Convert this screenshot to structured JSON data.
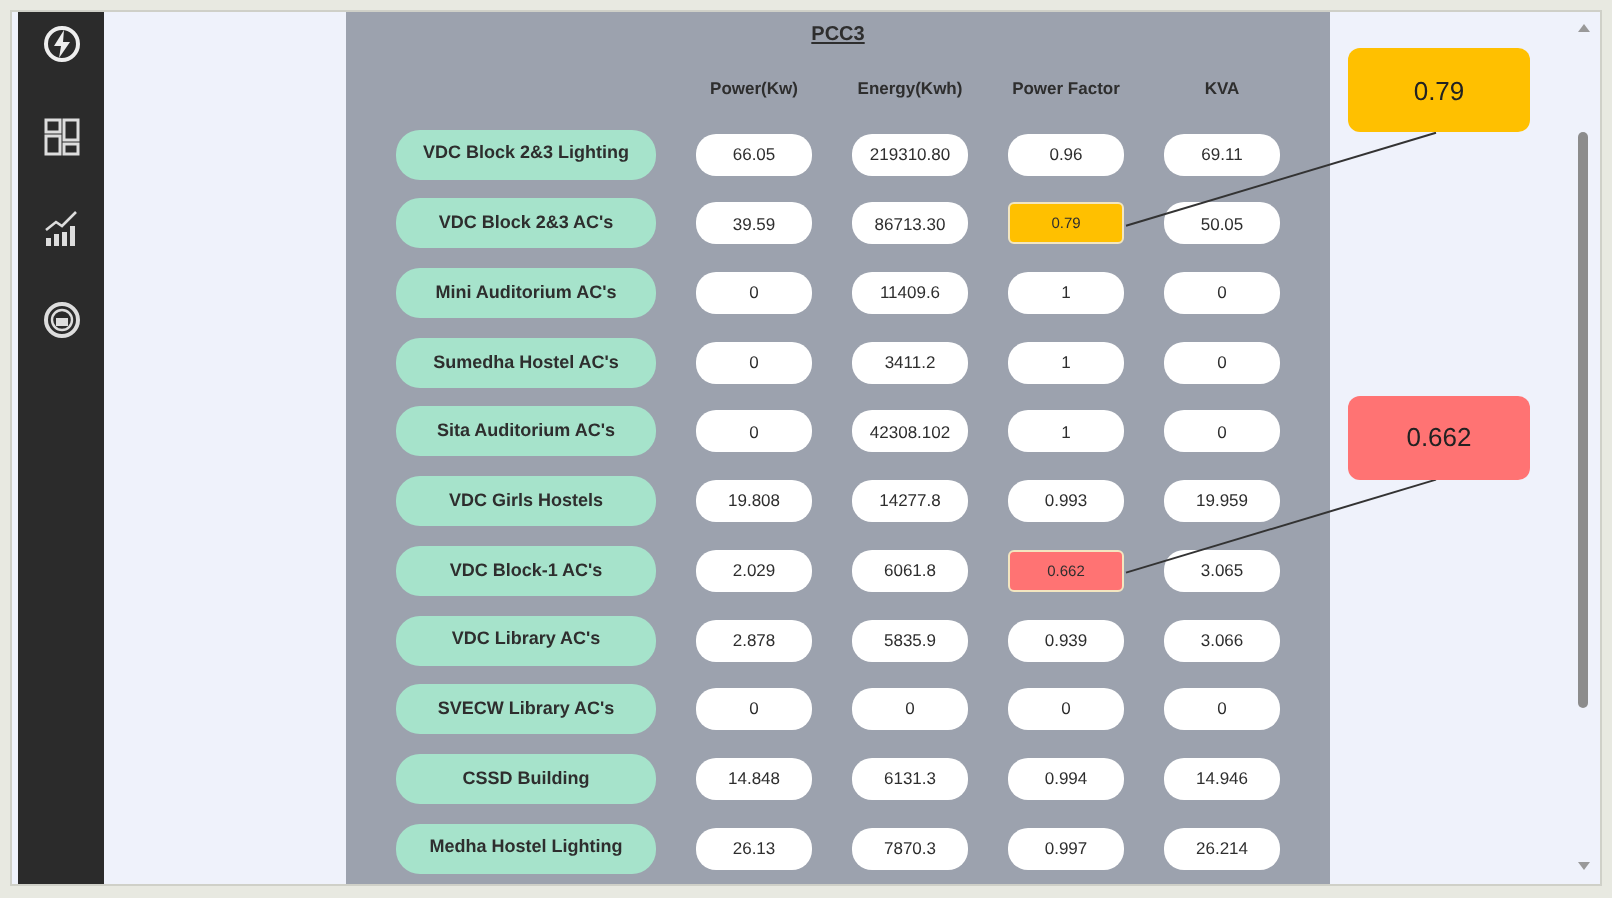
{
  "panel": {
    "title": "PCC3",
    "columns": [
      "Power(Kw)",
      "Energy(Kwh)",
      "Power Factor",
      "KVA"
    ],
    "rows": [
      {
        "name": "VDC Block 2&3 Lighting",
        "values": [
          "66.05",
          "219310.80",
          "0.96",
          "69.11"
        ]
      },
      {
        "name": "VDC Block 2&3 AC's",
        "values": [
          "39.59",
          "86713.30",
          {
            "text": "0.79",
            "color": "#ffc000",
            "callout": "0.79"
          },
          "50.05"
        ]
      },
      {
        "name": "Mini Auditorium AC's",
        "values": [
          "0",
          "11409.6",
          "1",
          "0"
        ]
      },
      {
        "name": "Sumedha Hostel AC's",
        "values": [
          "0",
          "3411.2",
          "1",
          "0"
        ]
      },
      {
        "name": "Sita Auditorium AC's",
        "values": [
          "0",
          "42308.102",
          "1",
          "0"
        ]
      },
      {
        "name": "VDC Girls Hostels",
        "values": [
          "19.808",
          "14277.8",
          "0.993",
          "19.959"
        ]
      },
      {
        "name": "VDC Block-1 AC's",
        "values": [
          "2.029",
          "6061.8",
          {
            "text": "0.662",
            "color": "#ff7373",
            "callout": "0.662"
          },
          "3.065"
        ]
      },
      {
        "name": "VDC Library AC's",
        "values": [
          "2.878",
          "5835.9",
          "0.939",
          "3.066"
        ]
      },
      {
        "name": "SVECW Library AC's",
        "values": [
          "0",
          "0",
          "0",
          "0"
        ]
      },
      {
        "name": "CSSD Building",
        "values": [
          "14.848",
          "6131.3",
          "0.994",
          "14.946"
        ]
      },
      {
        "name": "Medha Hostel Lighting",
        "values": [
          "26.13",
          "7870.3",
          "0.997",
          "26.214"
        ]
      }
    ]
  }
}
